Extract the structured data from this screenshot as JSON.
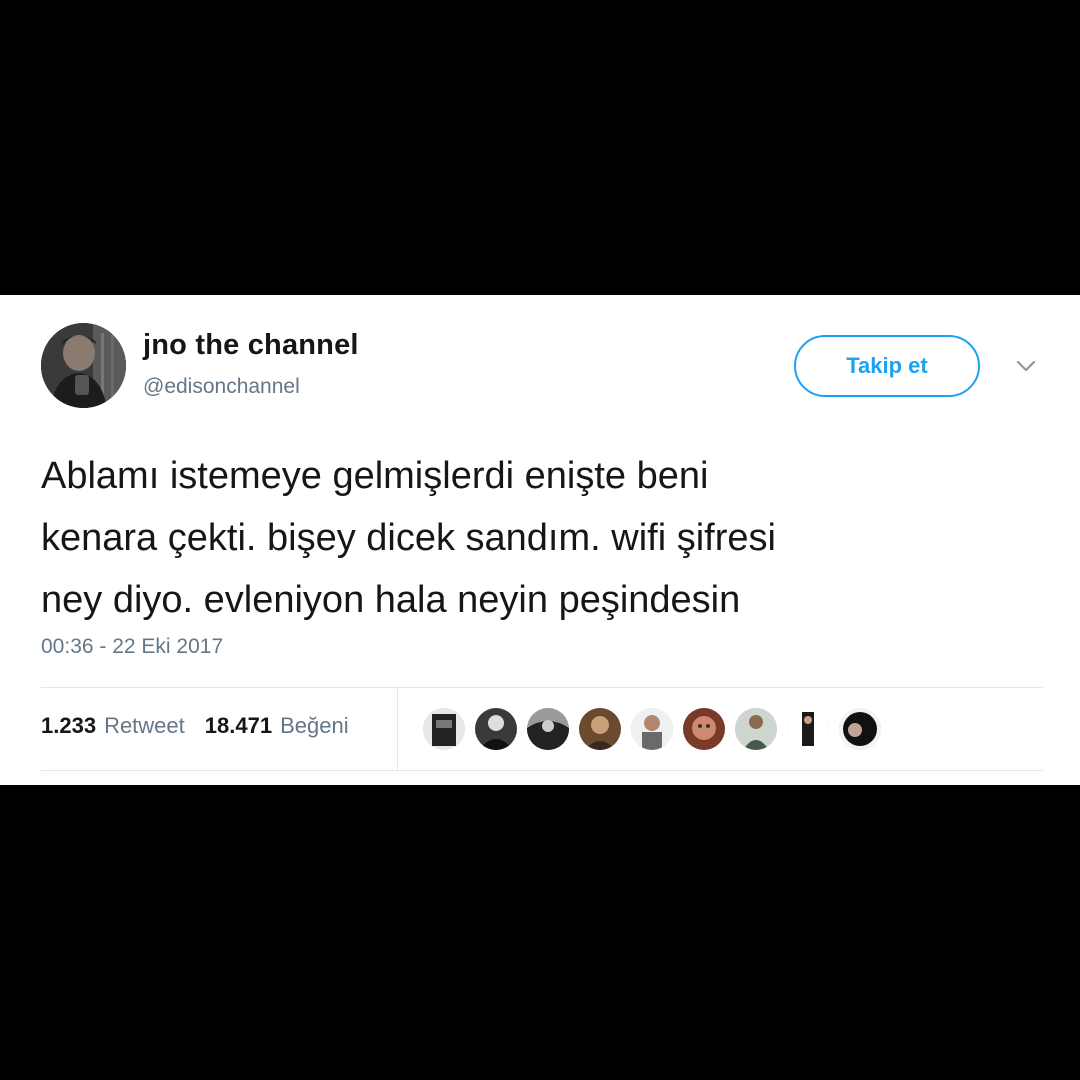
{
  "tweet": {
    "author": {
      "display_name": "jno the channel",
      "handle": "@edisonchannel"
    },
    "follow_button_label": "Takip et",
    "text_lines": [
      "Ablamı istemeye gelmişlerdi enişte beni",
      "kenara çekti. bişey dicek sandım. wifi şifresi",
      "ney diyo. evleniyon hala neyin peşindesin"
    ],
    "timestamp": "00:36 - 22 Eki 2017",
    "stats": {
      "retweets": {
        "count": "1.233",
        "label": "Retweet"
      },
      "likes": {
        "count": "18.471",
        "label": "Beğeni"
      }
    },
    "liker_avatars_count": 9
  },
  "colors": {
    "accent": "#1da1f2",
    "text_primary": "#14171a",
    "text_secondary": "#657786",
    "divider": "#e1e8ed",
    "page_background": "#000000",
    "card_background": "#ffffff"
  },
  "icons": {
    "menu": "chevron-down-icon"
  }
}
